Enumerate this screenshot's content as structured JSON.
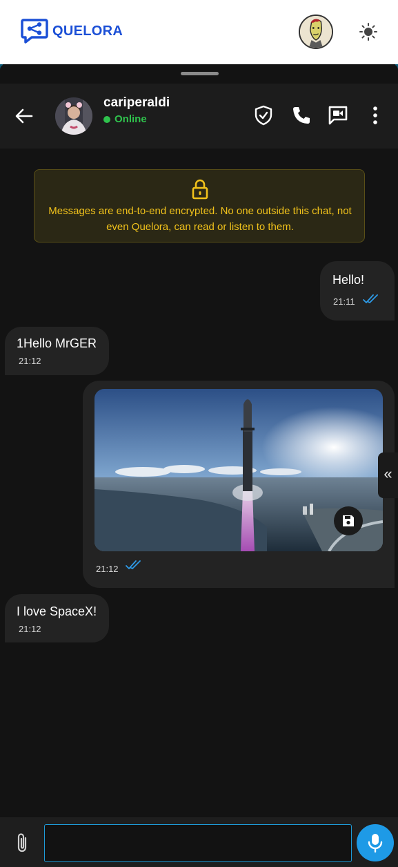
{
  "app": {
    "name": "QUELORA",
    "brand_color": "#1b4fd6"
  },
  "topbar": {
    "avatar_icon": "user-avatar-icon",
    "theme_icon": "sun-icon"
  },
  "chat": {
    "contact_name": "cariperaldi",
    "status": "Online",
    "status_color": "#2fc24d",
    "header_icons": [
      "shield-check-icon",
      "phone-icon",
      "video-call-icon",
      "more-vertical-icon"
    ]
  },
  "notice": {
    "text": "Messages are end-to-end encrypted. No one outside this chat, not even Quelora, can read or listen to them.",
    "color": "#f1c21b"
  },
  "messages": [
    {
      "direction": "outgoing",
      "text": "Hello!",
      "time": "21:11",
      "read": true
    },
    {
      "direction": "incoming",
      "text": "1Hello MrGER",
      "time": "21:12"
    },
    {
      "direction": "outgoing",
      "type": "image",
      "image_desc": "rocket launch over coastline",
      "time": "21:12",
      "read": true
    },
    {
      "direction": "incoming",
      "text": "I love SpaceX!",
      "time": "21:12"
    }
  ],
  "side_toggle": "«",
  "composer": {
    "value": "",
    "placeholder": ""
  }
}
